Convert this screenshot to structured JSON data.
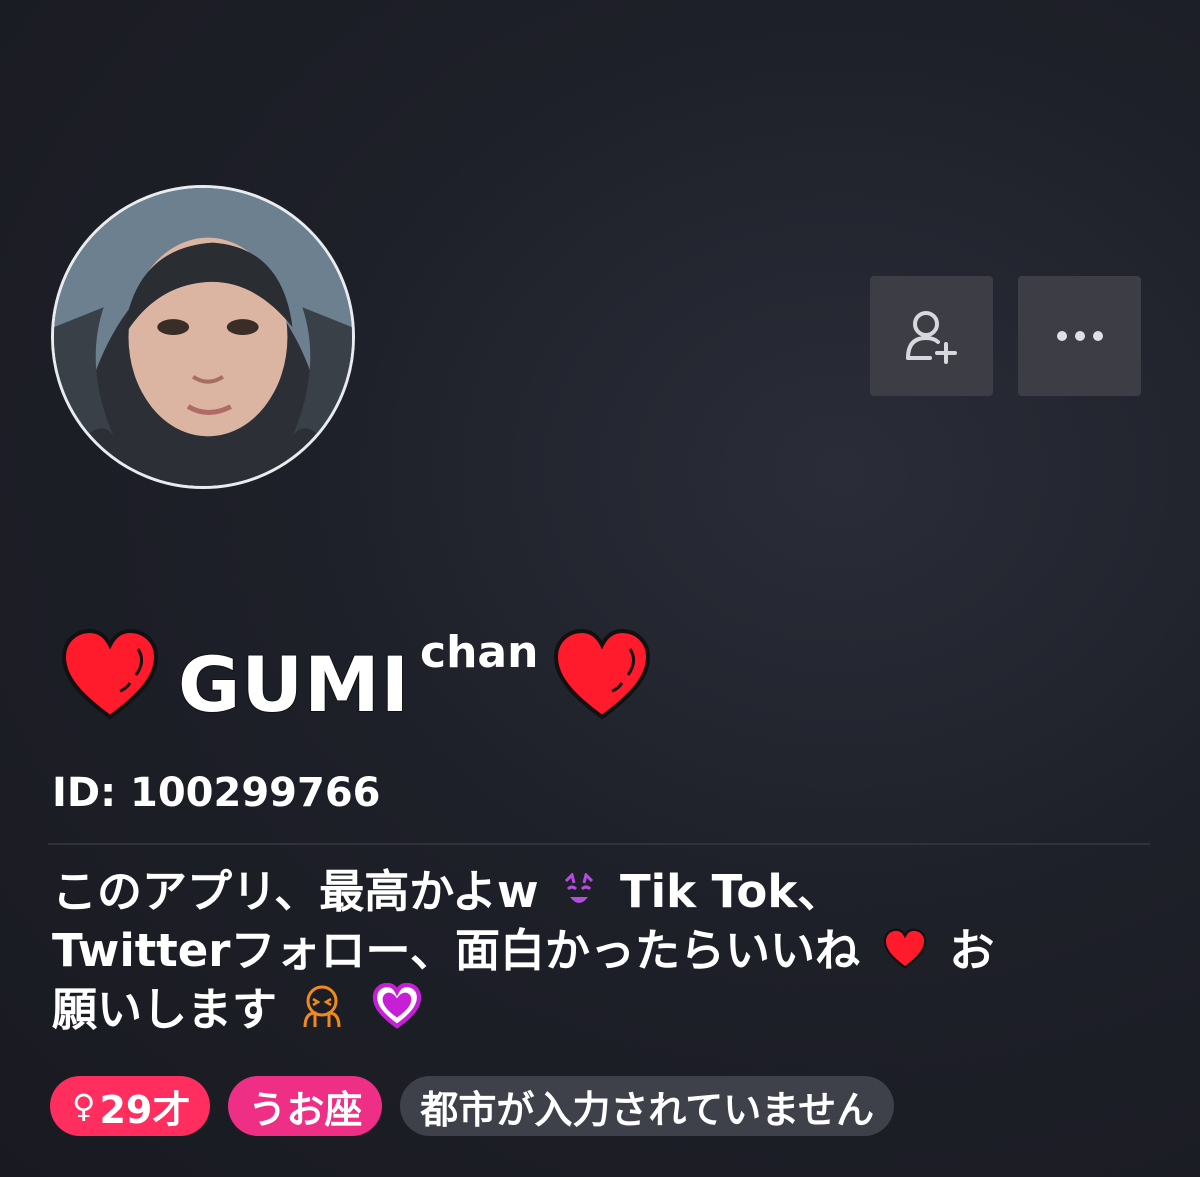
{
  "profile": {
    "name_main": "GUMI",
    "name_suffix": "chan",
    "user_id": "ID: 100299766",
    "bio_lines": [
      "このアプリ、最高かよw",
      "Tik Tok、",
      "Twitterフォロー、面白かったらいいね",
      "お",
      "願いします"
    ]
  },
  "actions": {
    "follow_icon": "add-user-icon",
    "more_icon": "more-horizontal-icon"
  },
  "tags": {
    "age": "29才",
    "gender_icon": "♀",
    "zodiac": "うお座",
    "city": "都市が入力されていません"
  },
  "colors": {
    "background": "#1e2029",
    "heart": "#ff1a2c",
    "tag_age": "#ff2e5e",
    "tag_sign": "#ef2f86",
    "tag_city": "#3e4149",
    "button_bg": "#3d3e45"
  }
}
